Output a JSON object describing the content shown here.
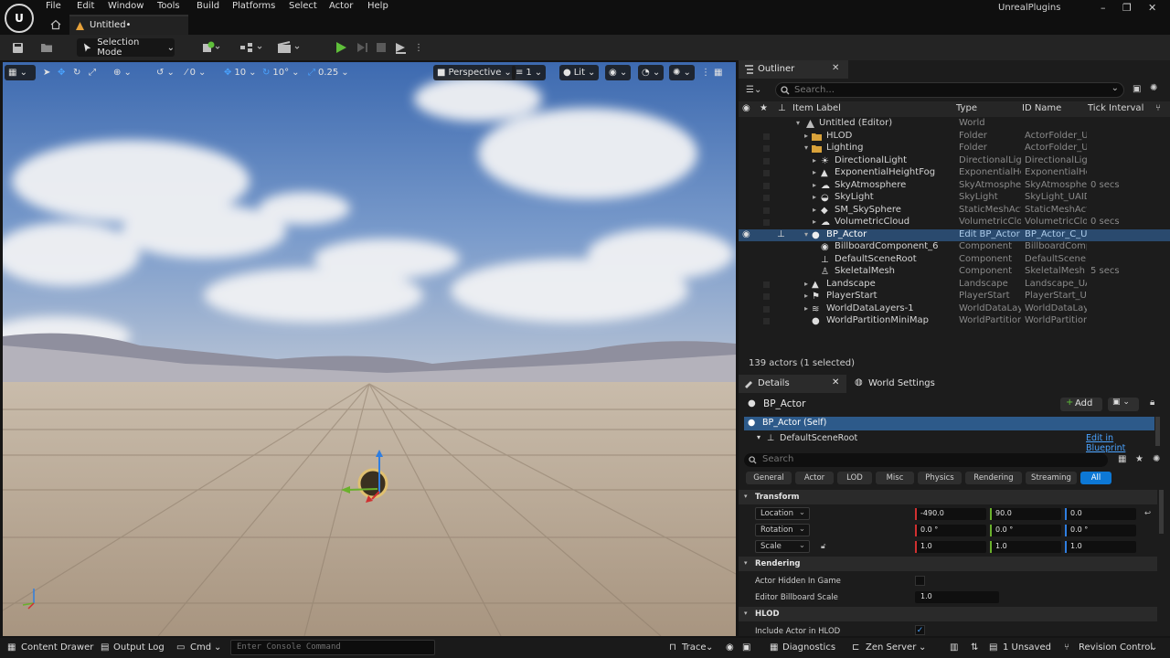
{
  "app": {
    "title": "UnrealPlugins",
    "document_tab": "Untitled•"
  },
  "menu": [
    "File",
    "Edit",
    "Window",
    "Tools",
    "Build",
    "Platforms",
    "Select",
    "Actor",
    "Help"
  ],
  "toolbar": {
    "mode_label": "Selection Mode"
  },
  "viewport": {
    "grid_snap": "0",
    "location_snap": "10",
    "rotation_snap": "10°",
    "scale_snap": "0.25",
    "perspective": "Perspective",
    "camera_speed": "1",
    "view_mode": "Lit"
  },
  "outliner": {
    "tab_label": "Outliner",
    "search_placeholder": "Search...",
    "columns": {
      "item_label": "Item Label",
      "type": "Type",
      "id_name": "ID Name",
      "tick_interval": "Tick Interval"
    },
    "rows": [
      {
        "label": "Untitled (Editor)",
        "type": "World",
        "id": "",
        "tick": ""
      },
      {
        "label": "HLOD",
        "type": "Folder",
        "id": "ActorFolder_UI",
        "tick": ""
      },
      {
        "label": "Lighting",
        "type": "Folder",
        "id": "ActorFolder_UI",
        "tick": ""
      },
      {
        "label": "DirectionalLight",
        "type": "DirectionalLigh",
        "id": "DirectionalLigh",
        "tick": ""
      },
      {
        "label": "ExponentialHeightFog",
        "type": "ExponentialHei",
        "id": "ExponentialHei",
        "tick": ""
      },
      {
        "label": "SkyAtmosphere",
        "type": "SkyAtmosphere",
        "id": "SkyAtmosphere",
        "tick": "0 secs"
      },
      {
        "label": "SkyLight",
        "type": "SkyLight",
        "id": "SkyLight_UAID",
        "tick": ""
      },
      {
        "label": "SM_SkySphere",
        "type": "StaticMeshAct",
        "id": "StaticMeshAct",
        "tick": ""
      },
      {
        "label": "VolumetricCloud",
        "type": "VolumetricClou",
        "id": "VolumetricClou",
        "tick": "0 secs"
      },
      {
        "label": "BP_Actor",
        "type": "Edit BP_Actor",
        "id": "BP_Actor_C_UA",
        "tick": ""
      },
      {
        "label": "BillboardComponent_6",
        "type": "Component",
        "id": "BillboardComp",
        "tick": ""
      },
      {
        "label": "DefaultSceneRoot",
        "type": "Component",
        "id": "DefaultSceneR",
        "tick": ""
      },
      {
        "label": "SkeletalMesh",
        "type": "Component",
        "id": "SkeletalMesh",
        "tick": "5 secs"
      },
      {
        "label": "Landscape",
        "type": "Landscape",
        "id": "Landscape_UA",
        "tick": ""
      },
      {
        "label": "PlayerStart",
        "type": "PlayerStart",
        "id": "PlayerStart_UA",
        "tick": ""
      },
      {
        "label": "WorldDataLayers-1",
        "type": "WorldDataLaye",
        "id": "WorldDataLaye",
        "tick": ""
      },
      {
        "label": "WorldPartitionMiniMap",
        "type": "WorldPartition",
        "id": "WorldPartition",
        "tick": ""
      }
    ],
    "status": "139 actors (1 selected)"
  },
  "details": {
    "tab_label": "Details",
    "world_settings_tab": "World Settings",
    "actor_name": "BP_Actor",
    "add_label": "Add",
    "self_label": "BP_Actor (Self)",
    "root_label": "DefaultSceneRoot",
    "edit_blueprint": "Edit in Blueprint",
    "search_placeholder": "Search",
    "filters": [
      "General",
      "Actor",
      "LOD",
      "Misc",
      "Physics",
      "Rendering",
      "Streaming",
      "All"
    ],
    "transform_section": "Transform",
    "location_label": "Location",
    "location": [
      "-490.0",
      "90.0",
      "0.0"
    ],
    "rotation_label": "Rotation",
    "rotation": [
      "0.0 °",
      "0.0 °",
      "0.0 °"
    ],
    "scale_label": "Scale",
    "scale": [
      "1.0",
      "1.0",
      "1.0"
    ],
    "rendering_section": "Rendering",
    "hidden_label": "Actor Hidden In Game",
    "billboard_scale_label": "Editor Billboard Scale",
    "billboard_scale": "1.0",
    "hlod_section": "HLOD",
    "include_hlod_label": "Include Actor in HLOD"
  },
  "bottom": {
    "content_drawer": "Content Drawer",
    "output_log": "Output Log",
    "cmd": "Cmd",
    "console_placeholder": "Enter Console Command",
    "trace": "Trace",
    "diagnostics": "Diagnostics",
    "zen_server": "Zen Server",
    "unsaved": "1 Unsaved",
    "revision_control": "Revision Control"
  },
  "colors": {
    "accent": "#0d78d5",
    "selection": "#2a4a6e",
    "play_green": "#5fbf3a",
    "x_axis": "#d03030",
    "y_axis": "#6ab02c",
    "z_axis": "#2f7ee0"
  }
}
